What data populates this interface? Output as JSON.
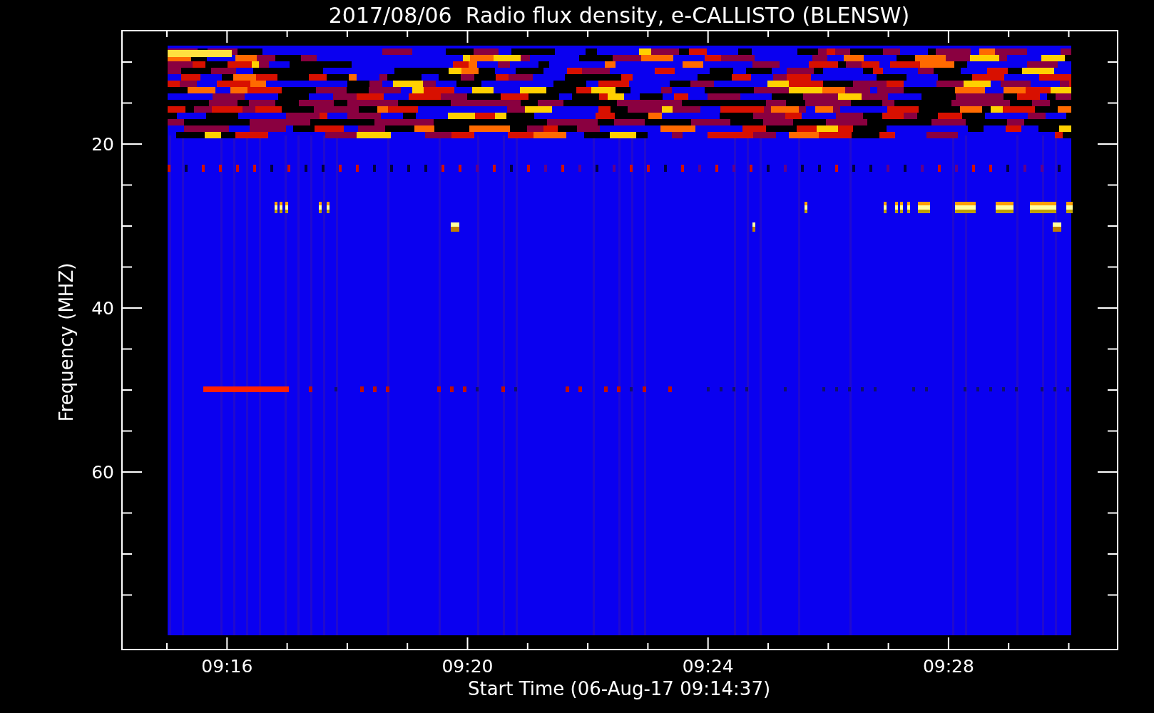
{
  "title": "2017/08/06  Radio flux density, e-CALLISTO (BLENSW)",
  "y_axis": {
    "label": "Frequency (MHZ)",
    "tick_labels": [
      "20",
      "40",
      "60"
    ]
  },
  "x_axis": {
    "label": "Start Time (06-Aug-17 09:14:37)",
    "tick_labels": [
      "09:16",
      "09:20",
      "09:24",
      "09:28"
    ]
  }
}
